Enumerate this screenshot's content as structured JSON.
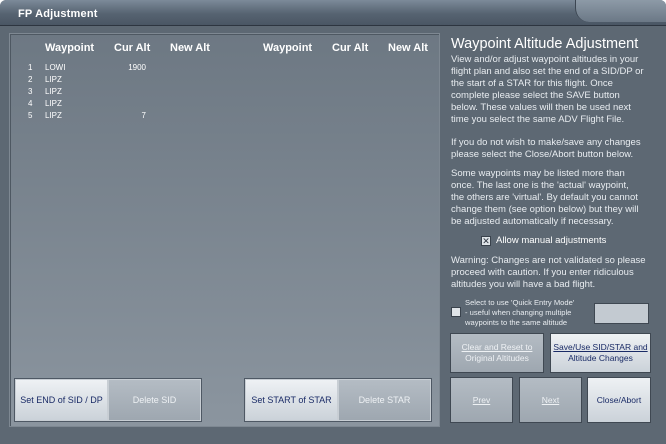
{
  "window": {
    "title": "FP Adjustment"
  },
  "table": {
    "headers": {
      "waypoint": "Waypoint",
      "cur_alt": "Cur Alt",
      "new_alt": "New Alt"
    },
    "rows": [
      {
        "num": "1",
        "waypoint": "LOWI",
        "cur_alt": "1900"
      },
      {
        "num": "2",
        "waypoint": "LIPZ",
        "cur_alt": ""
      },
      {
        "num": "3",
        "waypoint": "LIPZ",
        "cur_alt": ""
      },
      {
        "num": "4",
        "waypoint": "LIPZ",
        "cur_alt": ""
      },
      {
        "num": "5",
        "waypoint": "LIPZ",
        "cur_alt": "7"
      }
    ]
  },
  "buttons": {
    "set_end_sid": "Set END of SID / DP",
    "delete_sid": "Delete SID",
    "set_start_star": "Set START of STAR",
    "delete_star": "Delete STAR",
    "clear_reset_line1": "Clear and Reset to",
    "clear_reset_line2": "Original Altitudes",
    "save_use_line1": "Save/Use SID/STAR and",
    "save_use_line2": "Altitude Changes",
    "prev": "Prev",
    "next": "Next",
    "close_abort": "Close/Abort"
  },
  "info": {
    "heading": "Waypoint Altitude Adjustment",
    "para1_lines": [
      "View and/or adjust waypoint altitudes in your",
      "flight plan and also set the end of a SID/DP or",
      "the start of a STAR for this flight. Once",
      "complete please select the SAVE button",
      "below. These values will then be used next",
      "time you select the same ADV Flight File."
    ],
    "para2_lines": [
      "If you do not wish to make/save any changes",
      "please select the Close/Abort button below."
    ],
    "para3_lines": [
      "Some waypoints may be listed more than",
      "once. The last one is the 'actual' waypoint,",
      "the others are 'virtual'. By default you cannot",
      "change them (see option below) but they will",
      "be adjusted automatically if necessary."
    ],
    "manual_adjust_label": "Allow manual adjustments",
    "manual_adjust_mark": "✕",
    "warning_lines": [
      "Warning: Changes are not validated so please",
      "proceed with caution. If you enter ridiculous",
      "altitudes you will have a bad flight."
    ],
    "quick_entry_lines": [
      "Select to use 'Quick Entry Mode'",
      "- useful when changing multiple",
      "waypoints to the same altitude"
    ],
    "quick_entry_value": ""
  },
  "colors": {
    "window_bg": "#5d6873",
    "button_text_active": "#1a2b66"
  }
}
